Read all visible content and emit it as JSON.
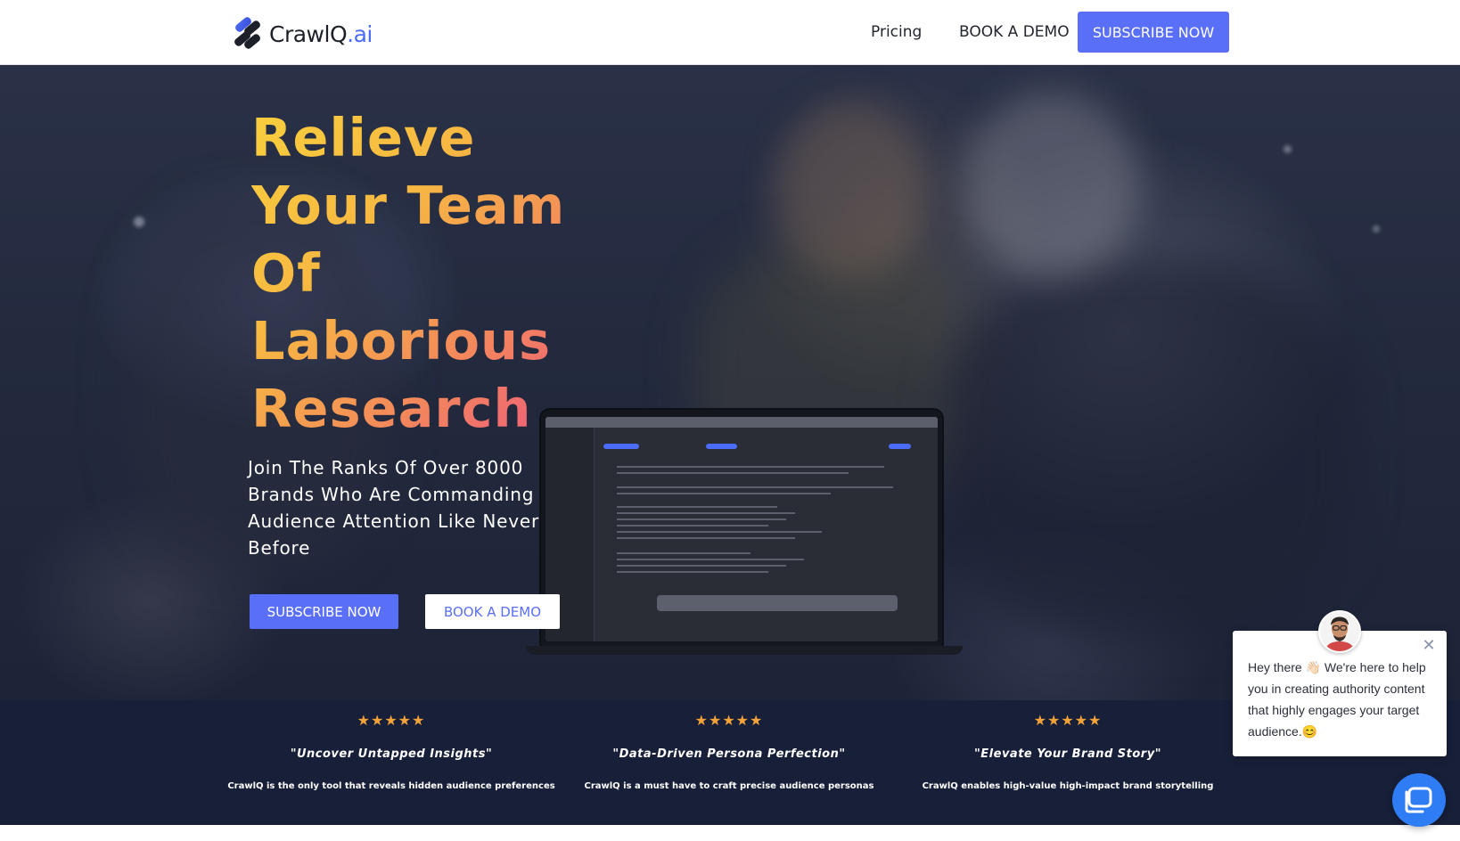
{
  "header": {
    "logo_text": "CrawlQ",
    "logo_suffix": ".ai",
    "nav": {
      "pricing": "Pricing",
      "book_demo": "BOOK A DEMO",
      "subscribe": "SUBSCRIBE NOW"
    }
  },
  "hero": {
    "title": "Relieve Your Team Of Laborious Research",
    "subtitle": "Join The Ranks Of Over 8000 Brands Who Are Commanding Audience Attention Like Never Before",
    "cta_subscribe": "SUBSCRIBE NOW",
    "cta_demo": "BOOK A DEMO"
  },
  "testimonials": [
    {
      "rating": 5,
      "stars": "★★★★★",
      "quote": "\"Uncover Untapped Insights\"",
      "text": "CrawlQ is the only tool that reveals hidden audience preferences"
    },
    {
      "rating": 5,
      "stars": "★★★★★",
      "quote": "\"Data-Driven Persona Perfection\"",
      "text": "CrawlQ is a must have to craft precise audience personas"
    },
    {
      "rating": 5,
      "stars": "★★★★★",
      "quote": "\"Elevate Your Brand Story\"",
      "text": "CrawlQ enables high-value high-impact brand storytelling"
    }
  ],
  "chat": {
    "message": "Hey there 👋🏻 We're here to help you in creating authority content that highly engages your target audience.😊",
    "close_icon": "close-icon",
    "launcher_icon": "chat-bubble-icon"
  },
  "colors": {
    "accent": "#5a6ff8",
    "testimonial_bg": "#182039",
    "star": "#f4a338",
    "title_gradient_start": "#f8cf3d",
    "title_gradient_end": "#ee4f84",
    "chat_launcher": "#2f7df5"
  }
}
